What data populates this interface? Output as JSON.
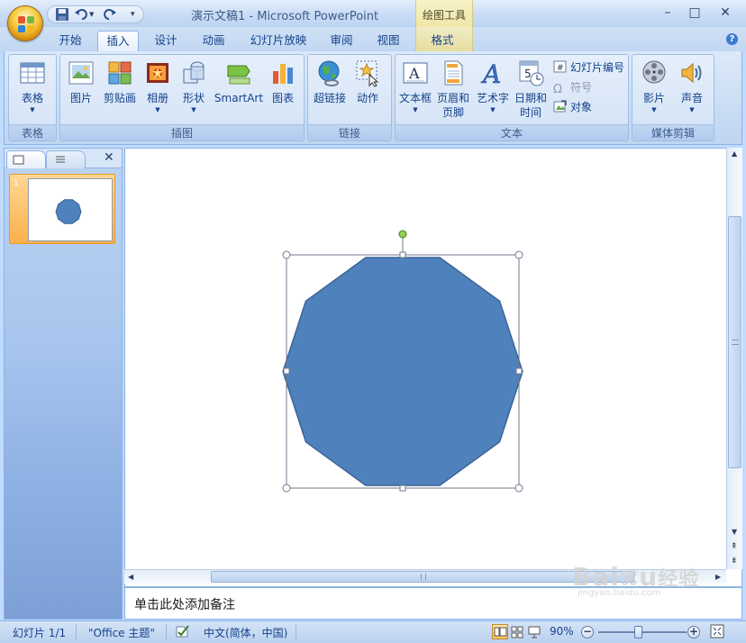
{
  "window": {
    "title": "演示文稿1 - Microsoft PowerPoint",
    "context_tab": "绘图工具",
    "minimize": "–",
    "maximize": "□",
    "close": "✕"
  },
  "tabs": [
    {
      "label": "开始"
    },
    {
      "label": "插入",
      "active": true
    },
    {
      "label": "设计"
    },
    {
      "label": "动画"
    },
    {
      "label": "幻灯片放映"
    },
    {
      "label": "审阅"
    },
    {
      "label": "视图"
    },
    {
      "label": "格式"
    }
  ],
  "ribbon": {
    "groups": {
      "tables": {
        "label": "表格",
        "table": "表格"
      },
      "illustrations": {
        "label": "插图",
        "picture": "图片",
        "clipart": "剪贴画",
        "album": "相册",
        "shapes": "形状",
        "smartart": "SmartArt",
        "chart": "图表"
      },
      "links": {
        "label": "链接",
        "hyperlink": "超链接",
        "action": "动作"
      },
      "text": {
        "label": "文本",
        "textbox": "文本框",
        "header_footer_1": "页眉和",
        "header_footer_2": "页脚",
        "wordart": "艺术字",
        "datetime_1": "日期和",
        "datetime_2": "时间",
        "slide_number": "幻灯片编号",
        "symbol": "符号",
        "object": "对象"
      },
      "media": {
        "label": "媒体剪辑",
        "movie": "影片",
        "sound": "声音"
      }
    }
  },
  "slide_pane": {
    "thumb_number": "1",
    "close": "✕"
  },
  "notes": {
    "placeholder": "单击此处添加备注"
  },
  "status": {
    "slide": "幻灯片 1/1",
    "theme": "\"Office 主题\"",
    "language": "中文(简体，中国)",
    "zoom": "90%",
    "zoom_level": 0.45
  },
  "shape": {
    "type": "decagon",
    "fill": "#4f81bd",
    "stroke": "#3a6396"
  },
  "watermark": {
    "text": "Baidu经验",
    "sub": "jingyan.baidu.com"
  }
}
